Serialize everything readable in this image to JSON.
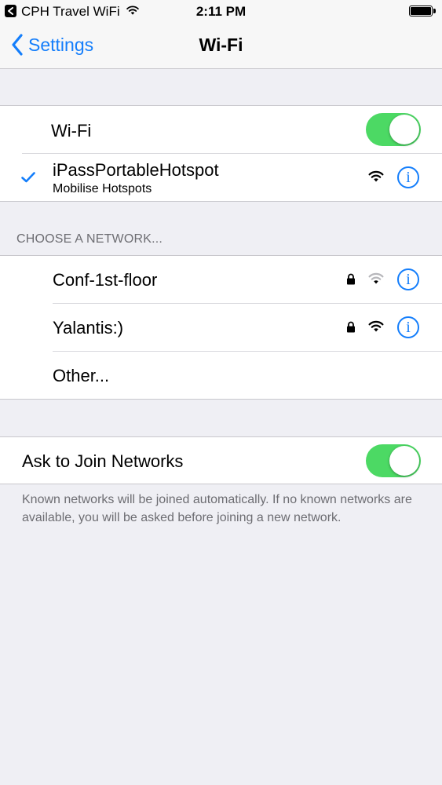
{
  "status_bar": {
    "carrier": "CPH Travel WiFi",
    "time": "2:11 PM"
  },
  "nav": {
    "back_label": "Settings",
    "title": "Wi-Fi"
  },
  "wifi_toggle": {
    "label": "Wi-Fi",
    "on": true
  },
  "connected_network": {
    "name": "iPassPortableHotspot",
    "subtitle": "Mobilise Hotspots",
    "signal_bars": 3,
    "secured": false
  },
  "choose_network": {
    "header": "CHOOSE A NETWORK...",
    "networks": [
      {
        "name": "Conf-1st-floor",
        "secured": true,
        "signal_bars": 1
      },
      {
        "name": "Yalantis:)",
        "secured": true,
        "signal_bars": 3
      }
    ],
    "other_label": "Other..."
  },
  "ask_to_join": {
    "label": "Ask to Join Networks",
    "on": true,
    "footer": "Known networks will be joined automatically. If no known networks are available, you will be asked before joining a new network."
  },
  "colors": {
    "accent": "#147efb",
    "toggle_on": "#4cd964",
    "background": "#efeff4",
    "secondary_text": "#6d6d72"
  },
  "icons": {
    "back": "chevron-left-icon",
    "checkmark": "checkmark-icon",
    "wifi": "wifi-signal-icon",
    "lock": "lock-icon",
    "info": "info-icon",
    "info_glyph": "i"
  }
}
